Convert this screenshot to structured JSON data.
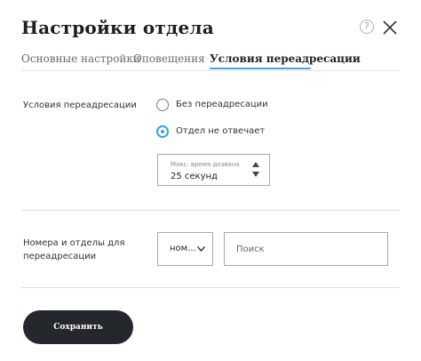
{
  "dialog": {
    "title": "Настройки отдела",
    "help_icon": "?"
  },
  "tabs": [
    {
      "label": "Основные настройки",
      "active": false
    },
    {
      "label": "Оповещения",
      "active": false
    },
    {
      "label": "Условия переадресации",
      "active": true
    }
  ],
  "forwarding": {
    "label": "Условия переадресации",
    "options": [
      {
        "label": "Без переадресации",
        "checked": false
      },
      {
        "label": "Отдел не отвечает",
        "checked": true
      }
    ],
    "ring_time": {
      "caption": "Макс. время дозвона",
      "value": "25 секунд"
    }
  },
  "numbers": {
    "label": "Номера и отделы для переадресации",
    "select_value": "ном...",
    "search_placeholder": "Поиск"
  },
  "actions": {
    "save_label": "Сохранить"
  },
  "colors": {
    "accent": "#35a3e0",
    "button_bg": "#24272c"
  }
}
